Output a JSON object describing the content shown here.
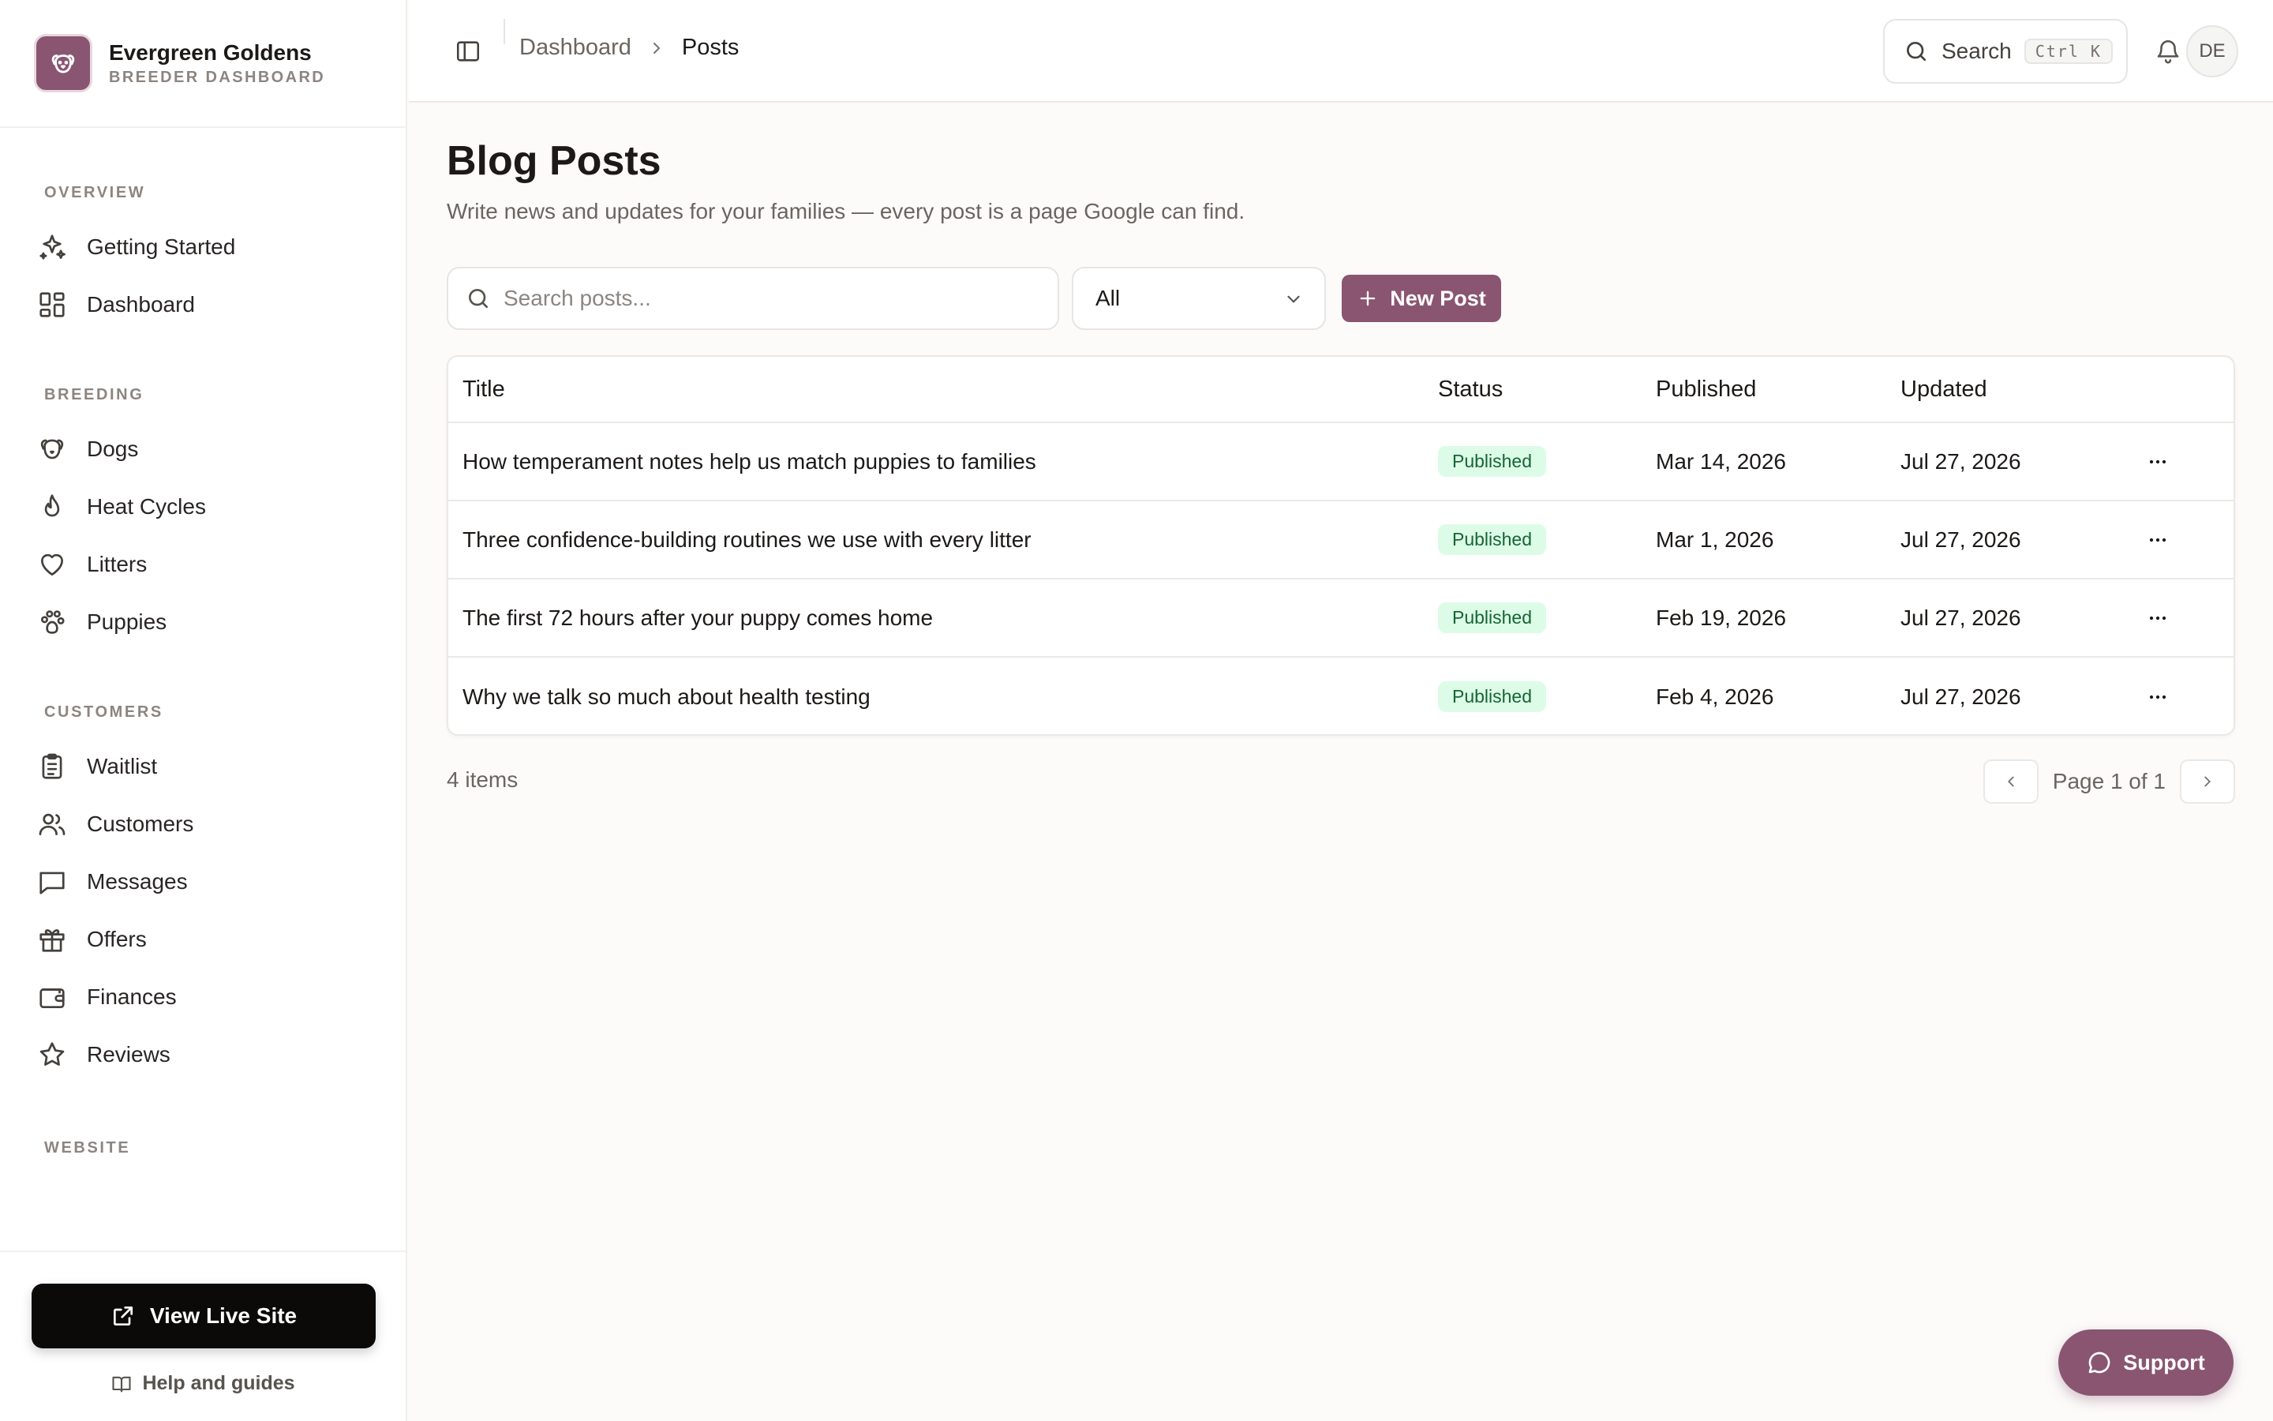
{
  "brand": {
    "name": "Evergreen Goldens",
    "subtitle": "BREEDER DASHBOARD",
    "logo_icon": "dog-face-icon",
    "accent": "#8a5571"
  },
  "sidebar": {
    "sections": [
      {
        "heading": "OVERVIEW",
        "items": [
          {
            "label": "Getting Started",
            "icon": "sparkles-icon"
          },
          {
            "label": "Dashboard",
            "icon": "layout-grid-icon"
          }
        ]
      },
      {
        "heading": "BREEDING",
        "items": [
          {
            "label": "Dogs",
            "icon": "dog-icon"
          },
          {
            "label": "Heat Cycles",
            "icon": "flame-icon"
          },
          {
            "label": "Litters",
            "icon": "heart-icon"
          },
          {
            "label": "Puppies",
            "icon": "paw-icon"
          }
        ]
      },
      {
        "heading": "CUSTOMERS",
        "items": [
          {
            "label": "Waitlist",
            "icon": "clipboard-list-icon"
          },
          {
            "label": "Customers",
            "icon": "users-icon"
          },
          {
            "label": "Messages",
            "icon": "message-square-icon"
          },
          {
            "label": "Offers",
            "icon": "gift-icon"
          },
          {
            "label": "Finances",
            "icon": "wallet-icon"
          },
          {
            "label": "Reviews",
            "icon": "star-icon"
          }
        ]
      },
      {
        "heading": "WEBSITE",
        "items": []
      }
    ],
    "view_live_site": "View Live Site",
    "help_link": "Help and guides"
  },
  "header": {
    "breadcrumb": {
      "home": "Dashboard",
      "current": "Posts"
    },
    "search_label": "Search",
    "search_shortcut": "Ctrl K",
    "avatar_initials": "DE"
  },
  "main": {
    "title": "Blog Posts",
    "subtitle": "Write news and updates for your families — every post is a page Google can find.",
    "search_placeholder": "Search posts...",
    "filter_value": "All",
    "new_post_label": "New Post",
    "columns": {
      "title": "Title",
      "status": "Status",
      "published": "Published",
      "updated": "Updated"
    },
    "rows": [
      {
        "title": "How temperament notes help us match puppies to families",
        "status": "Published",
        "published": "Mar 14, 2026",
        "updated": "Jul 27, 2026"
      },
      {
        "title": "Three confidence-building routines we use with every litter",
        "status": "Published",
        "published": "Mar 1, 2026",
        "updated": "Jul 27, 2026"
      },
      {
        "title": "The first 72 hours after your puppy comes home",
        "status": "Published",
        "published": "Feb 19, 2026",
        "updated": "Jul 27, 2026"
      },
      {
        "title": "Why we talk so much about health testing",
        "status": "Published",
        "published": "Feb 4, 2026",
        "updated": "Jul 27, 2026"
      }
    ],
    "items_count": "4 items",
    "page_label": "Page 1 of 1"
  },
  "support_label": "Support"
}
